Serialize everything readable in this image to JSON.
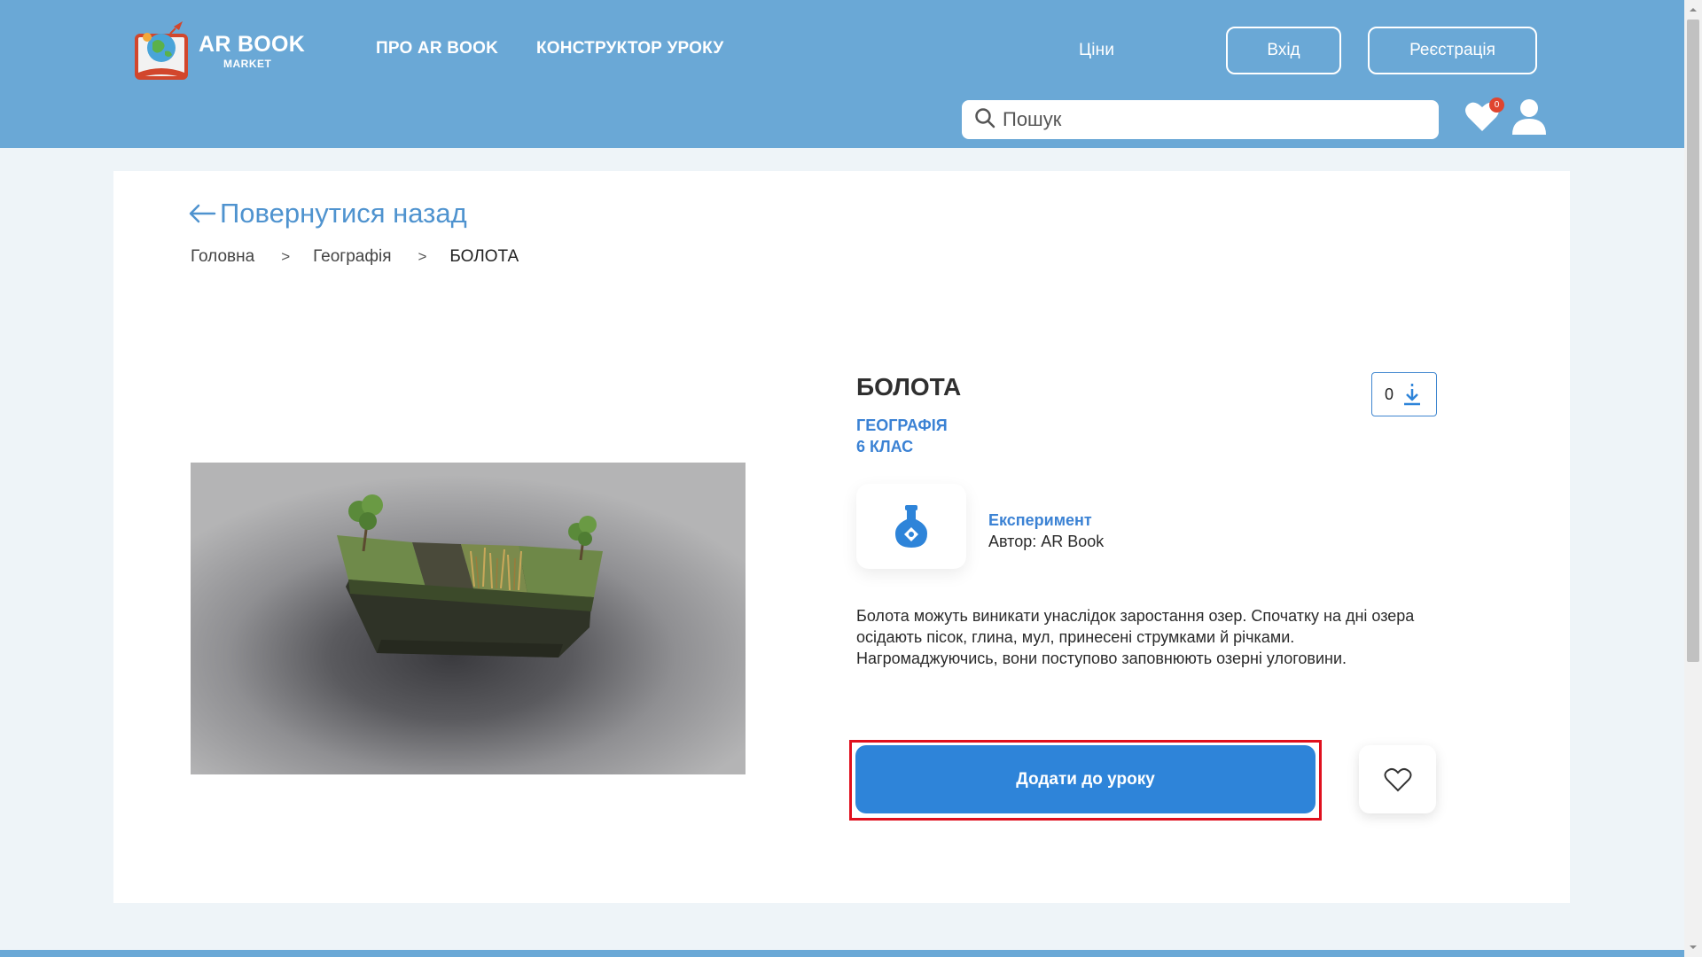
{
  "header": {
    "logo": {
      "title": "AR BOOK",
      "subtitle": "MARKET",
      "icon": "book-globe-logo"
    },
    "nav": {
      "about_label": "ПРО AR BOOK",
      "constructor_label": "КОНСТРУКТОР УРОКУ",
      "prices_label": "Ціни"
    },
    "login_label": "Вхід",
    "register_label": "Реєстрація",
    "search": {
      "placeholder": "Пошук",
      "value": "",
      "icon": "search-icon"
    },
    "favorites": {
      "count": "0",
      "icon": "heart-icon"
    },
    "user": {
      "icon": "user-icon"
    }
  },
  "back_link": {
    "label": "Повернутися назад",
    "icon": "arrow-left-icon"
  },
  "breadcrumb": {
    "items": [
      "Головна",
      "Географія",
      "БОЛОТА"
    ],
    "separator": ">"
  },
  "item": {
    "title": "БОЛОТА",
    "subject": "ГЕОГРАФІЯ",
    "grade": "6 КЛАС",
    "downloads": "0",
    "type": "Експеримент",
    "author": "Автор: AR Book",
    "type_icon": "flask-icon",
    "description": "Болота можуть виникати унаслідок заростання озер. Спочатку на дні озера осідають пісок, глина, мул, принесені струмками й річками. Нагромаджуючись, вони поступово заповнюють озерні улоговини."
  },
  "actions": {
    "add_label": "Додати до уроку",
    "favorite_icon": "heart-outline-icon"
  },
  "colors": {
    "header_bg": "#6aa8d6",
    "accent": "#2e84d9",
    "link": "#4f93cf",
    "highlight": "#e0101e",
    "badge": "#e0452f"
  }
}
